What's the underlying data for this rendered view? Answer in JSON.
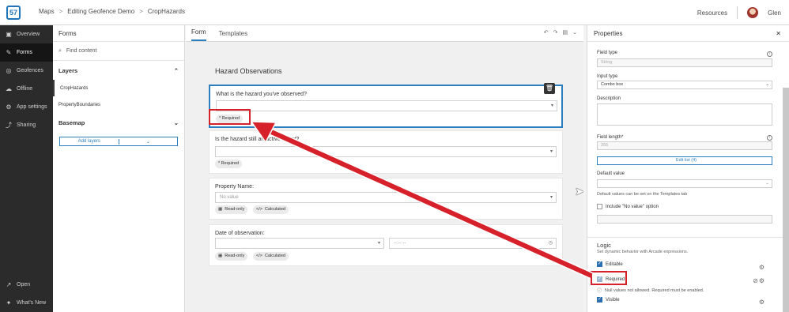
{
  "topbar": {
    "logo_glyph": "57",
    "breadcrumbs": [
      "Maps",
      "Editing Geofence Demo",
      "CropHazards"
    ],
    "resources_label": "Resources",
    "user_name": "Glen"
  },
  "leftnav": {
    "items": [
      {
        "icon": "overview-icon",
        "label": "Overview"
      },
      {
        "icon": "forms-icon",
        "label": "Forms"
      },
      {
        "icon": "geofences-icon",
        "label": "Geofences"
      },
      {
        "icon": "offline-icon",
        "label": "Offline"
      },
      {
        "icon": "settings-icon",
        "label": "App settings"
      },
      {
        "icon": "share-icon",
        "label": "Sharing"
      }
    ],
    "bottom": [
      {
        "icon": "open-icon",
        "label": "Open"
      },
      {
        "icon": "whats-new-icon",
        "label": "What's New"
      }
    ]
  },
  "forms_panel": {
    "title": "Forms",
    "search_placeholder": "Find content",
    "layers_heading": "Layers",
    "layers": [
      "CropHazards",
      "PropertyBoundaries"
    ],
    "basemap_heading": "Basemap",
    "add_layers_label": "Add layers"
  },
  "center": {
    "tabs": [
      "Form",
      "Templates"
    ],
    "form_title": "Hazard Observations",
    "fields": [
      {
        "label": "What is the hazard you've observed?",
        "value": "",
        "badges": [
          "* Required"
        ]
      },
      {
        "label": "Is the hazard still an active threat?",
        "value": "",
        "badges": [
          "* Required"
        ]
      },
      {
        "label": "Property Name:",
        "value": "No value",
        "badges": [
          "Read-only",
          "Calculated"
        ]
      },
      {
        "label": "Date of observation:",
        "value": "",
        "time_placeholder": "--:-- --",
        "badges": [
          "Read-only",
          "Calculated"
        ]
      }
    ]
  },
  "properties": {
    "title": "Properties",
    "field_type_label": "Field type",
    "field_type_value": "String",
    "input_type_label": "Input type",
    "input_type_value": "Combo box",
    "description_label": "Description",
    "field_length_label": "Field length*",
    "field_length_value": "255",
    "edit_list_label": "Edit list (4)",
    "default_value_label": "Default value",
    "default_value_note": "Default values can be set on the Templates tab",
    "include_no_value_label": "Include \"No value\" option",
    "logic_heading": "Logic",
    "logic_subtitle": "Set dynamic behavior with Arcade expressions.",
    "editable_label": "Editable",
    "required_label": "Required",
    "required_note": "Null values not allowed. Required must be enabled.",
    "visible_label": "Visible"
  },
  "colors": {
    "accent": "#2c7fbf",
    "annotation_red": "#d6202a",
    "nav_bg": "#2b2b2b"
  }
}
